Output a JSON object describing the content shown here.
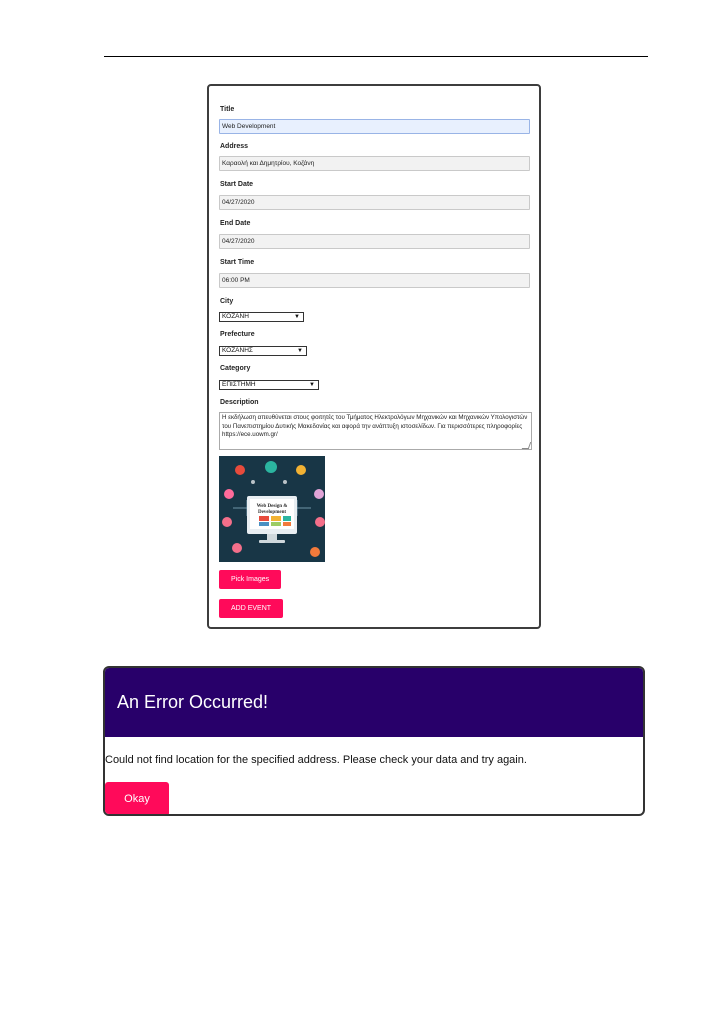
{
  "form": {
    "title_label": "Title",
    "title_value": "Web Development",
    "address_label": "Address",
    "address_value": "Καραολή και Δημητρίου, Κοζάνη",
    "start_date_label": "Start Date",
    "start_date_value": "04/27/2020",
    "end_date_label": "End Date",
    "end_date_value": "04/27/2020",
    "start_time_label": "Start Time",
    "start_time_value": "06:00 PM",
    "city_label": "City",
    "city_value": "ΚΟΖΑΝΗ",
    "prefecture_label": "Prefecture",
    "prefecture_value": "ΚΟΖΑΝΗΣ",
    "category_label": "Category",
    "category_value": "ΕΠΙΣΤΗΜΗ",
    "description_label": "Description",
    "description_value": "Η εκδήλωση απευθύνεται στους φοιτητές του Τμήματος Ηλεκτρολόγων Μηχανικών και Μηχανικών Υπολογιστών του Πανεπιστημίου Δυτικής Μακεδονίας και αφορά την ανάπτυξη ιστοσελίδων. Για περισσότερες πληροφορίες https://ece.uowm.gr/",
    "image_caption_line1": "Web Design &",
    "image_caption_line2": "Development",
    "pick_images_label": "Pick Images",
    "add_event_label": "ADD EVENT"
  },
  "dialog": {
    "title": "An Error Occurred!",
    "message": "Could not find location for the specified address. Please check your data and try again.",
    "okay_label": "Okay"
  },
  "colors": {
    "accent": "#ff0a5a",
    "dialog_header": "#28006a"
  }
}
